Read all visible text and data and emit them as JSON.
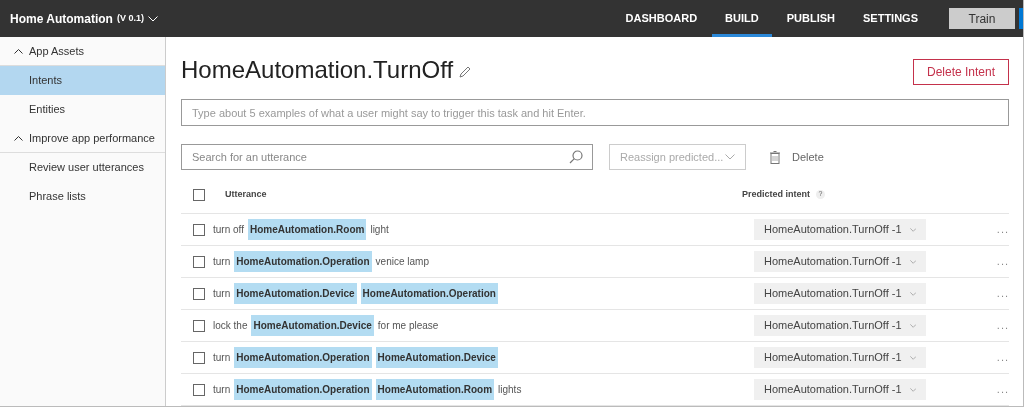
{
  "app": {
    "title": "Home Automation",
    "version": "(V 0.1)"
  },
  "nav": [
    {
      "label": "DASHBOARD",
      "selected": false
    },
    {
      "label": "BUILD",
      "selected": true
    },
    {
      "label": "PUBLISH",
      "selected": false
    },
    {
      "label": "SETTINGS",
      "selected": false
    }
  ],
  "train_button": "Train",
  "sidebar": [
    {
      "label": "App Assets",
      "expanded": true,
      "children": [
        {
          "label": "Intents",
          "selected": true
        },
        {
          "label": "Entities",
          "selected": false
        }
      ]
    },
    {
      "label": "Improve app performance",
      "expanded": true,
      "children": [
        {
          "label": "Review user utterances",
          "selected": false
        },
        {
          "label": "Phrase lists",
          "selected": false
        }
      ]
    }
  ],
  "intent_title": "HomeAutomation.TurnOff",
  "delete_intent_button": "Delete Intent",
  "example_input": {
    "placeholder": "Type about 5 examples of what a user might say to trigger this task and hit Enter."
  },
  "search": {
    "placeholder": "Search for an utterance"
  },
  "reassign_dropdown": {
    "placeholder": "Reassign predicted..."
  },
  "delete_button": "Delete",
  "table": {
    "columns": [
      "Utterance",
      "Predicted intent"
    ],
    "help": "?",
    "header_checked": false,
    "rows": [
      {
        "checked": false,
        "segments": [
          {
            "kind": "text",
            "text": "turn off"
          },
          {
            "kind": "entity",
            "text": "HomeAutomation.Room"
          },
          {
            "kind": "text",
            "text": "light"
          }
        ],
        "predicted": "HomeAutomation.TurnOff -1",
        "more": "..."
      },
      {
        "checked": false,
        "segments": [
          {
            "kind": "text",
            "text": "turn"
          },
          {
            "kind": "entity",
            "text": "HomeAutomation.Operation"
          },
          {
            "kind": "text",
            "text": "venice lamp"
          }
        ],
        "predicted": "HomeAutomation.TurnOff -1",
        "more": "..."
      },
      {
        "checked": false,
        "segments": [
          {
            "kind": "text",
            "text": "turn"
          },
          {
            "kind": "entity",
            "text": "HomeAutomation.Device"
          },
          {
            "kind": "entity",
            "text": "HomeAutomation.Operation"
          }
        ],
        "predicted": "HomeAutomation.TurnOff -1",
        "more": "..."
      },
      {
        "checked": false,
        "segments": [
          {
            "kind": "text",
            "text": "lock the"
          },
          {
            "kind": "entity",
            "text": "HomeAutomation.Device"
          },
          {
            "kind": "text",
            "text": "for me please"
          }
        ],
        "predicted": "HomeAutomation.TurnOff -1",
        "more": "..."
      },
      {
        "checked": false,
        "segments": [
          {
            "kind": "text",
            "text": "turn"
          },
          {
            "kind": "entity",
            "text": "HomeAutomation.Operation"
          },
          {
            "kind": "entity",
            "text": "HomeAutomation.Device"
          }
        ],
        "predicted": "HomeAutomation.TurnOff -1",
        "more": "..."
      },
      {
        "checked": false,
        "segments": [
          {
            "kind": "text",
            "text": "turn"
          },
          {
            "kind": "entity",
            "text": "HomeAutomation.Operation"
          },
          {
            "kind": "entity",
            "text": "HomeAutomation.Room"
          },
          {
            "kind": "text",
            "text": "lights"
          }
        ],
        "predicted": "HomeAutomation.TurnOff -1",
        "more": "..."
      }
    ]
  }
}
